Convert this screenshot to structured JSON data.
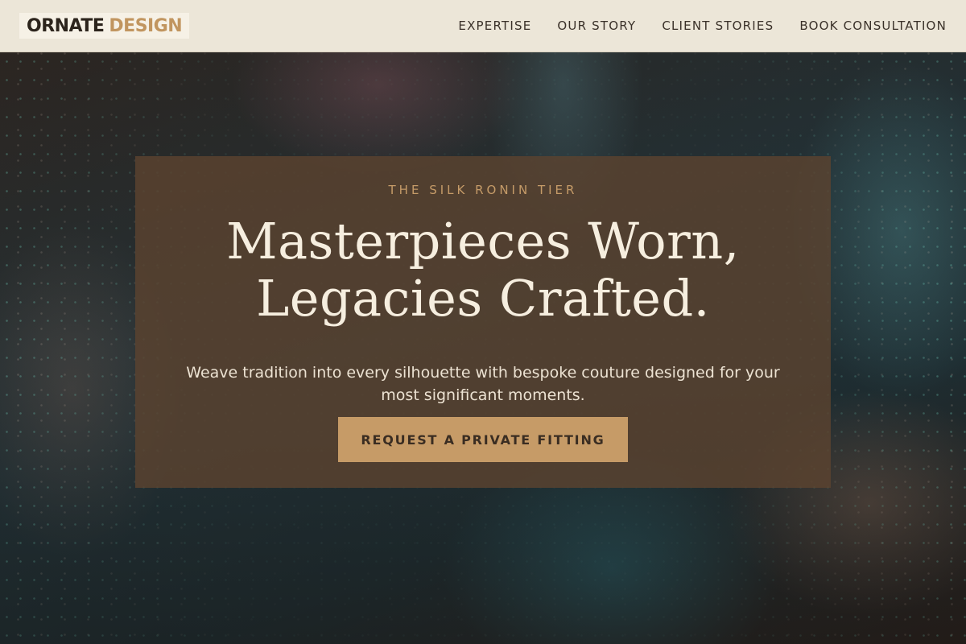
{
  "header": {
    "logo_part1": "ORNATE",
    "logo_part2": "DESIGN",
    "nav": [
      {
        "label": "EXPERTISE"
      },
      {
        "label": "OUR STORY"
      },
      {
        "label": "CLIENT STORIES"
      },
      {
        "label": "BOOK CONSULTATION"
      }
    ]
  },
  "hero": {
    "eyebrow": "THE SILK RONIN TIER",
    "headline_line1": "Masterpieces Worn,",
    "headline_line2": "Legacies Crafted.",
    "subtext": "Weave tradition into every silhouette with bespoke couture designed for your most significant moments.",
    "cta_label": "REQUEST A PRIVATE FITTING"
  },
  "colors": {
    "accent": "#c69b67",
    "header_bg": "#ece6d8",
    "card_bg": "#5c4430",
    "headline": "#f6eedf"
  }
}
